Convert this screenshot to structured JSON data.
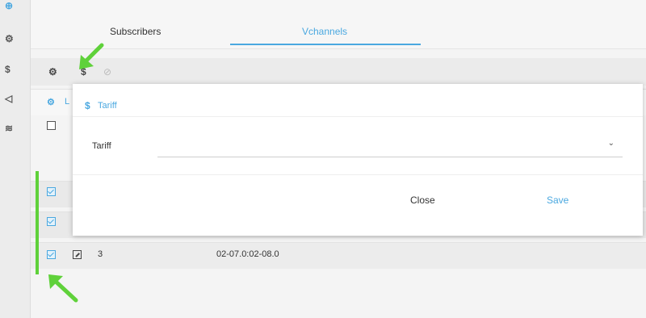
{
  "sidebar": {
    "items": [
      {
        "icon": "globe-icon",
        "glyph": "⊕"
      },
      {
        "icon": "users-icon",
        "glyph": "ₒ₆"
      },
      {
        "icon": "dollar-icon",
        "glyph": "$"
      },
      {
        "icon": "megaphone-icon",
        "glyph": "◁"
      },
      {
        "icon": "wifi-icon",
        "glyph": "≋"
      }
    ]
  },
  "tabs": [
    {
      "label": "Subscribers",
      "active": false
    },
    {
      "label": "Vchannels",
      "active": true
    }
  ],
  "toolbar": {
    "group_icon": "users-icon",
    "tariff_icon": "dollar-icon",
    "disabled_icon": "block-icon",
    "tariff_glyph": "$"
  },
  "table": {
    "header_fragment": "L",
    "row": {
      "number": "3",
      "range": "02-07.0:02-08.0"
    }
  },
  "modal": {
    "title": "Tariff",
    "title_icon": "$",
    "field_label": "Tariff",
    "field_value": "",
    "close_label": "Close",
    "save_label": "Save"
  },
  "colors": {
    "accent": "#4aa8e0",
    "highlight_green": "#5fd13a"
  }
}
